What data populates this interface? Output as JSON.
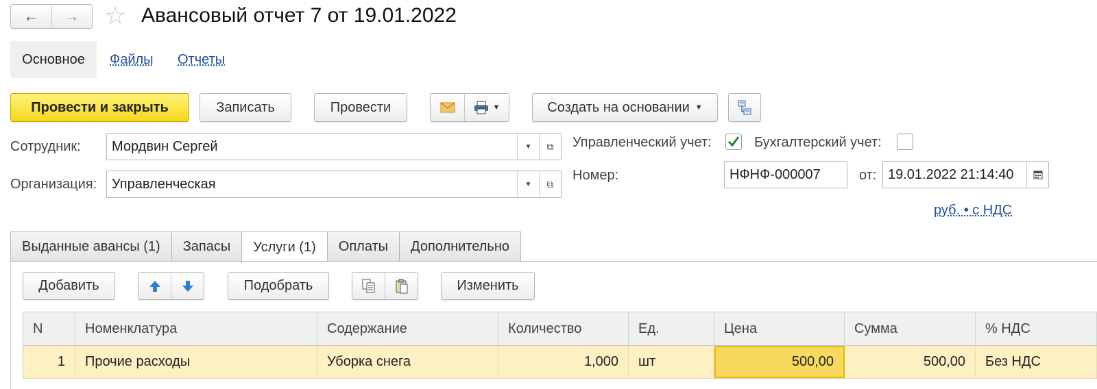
{
  "header": {
    "back_icon": "arrow-left-icon",
    "forward_icon": "arrow-right-icon",
    "favorite_icon": "star-icon",
    "title": "Авансовый отчет 7 от 19.01.2022"
  },
  "panel_tabs": [
    {
      "label": "Основное",
      "active": true
    },
    {
      "label": "Файлы",
      "active": false
    },
    {
      "label": "Отчеты",
      "active": false
    }
  ],
  "toolbar": {
    "post_close": "Провести и закрыть",
    "save": "Записать",
    "post": "Провести",
    "create_based": "Создать на основании"
  },
  "form": {
    "employee_label": "Сотрудник:",
    "employee_value": "Мордвин Сергей",
    "org_label": "Организация:",
    "org_value": "Управленческая",
    "mgmt_label": "Управленческий учет:",
    "mgmt_checked": true,
    "acct_label": "Бухгалтерский учет:",
    "acct_checked": false,
    "number_label": "Номер:",
    "number_value": "НФНФ-000007",
    "date_label": "от:",
    "date_value": "19.01.2022 21:14:40",
    "currency_link": "руб. • с НДС"
  },
  "tabs": [
    {
      "label": "Выданные авансы (1)",
      "active": false
    },
    {
      "label": "Запасы",
      "active": false
    },
    {
      "label": "Услуги (1)",
      "active": true
    },
    {
      "label": "Оплаты",
      "active": false
    },
    {
      "label": "Дополнительно",
      "active": false
    }
  ],
  "grid_toolbar": {
    "add": "Добавить",
    "pick": "Подобрать",
    "change": "Изменить"
  },
  "table": {
    "columns": [
      "N",
      "Номенклатура",
      "Содержание",
      "Количество",
      "Ед.",
      "Цена",
      "Сумма",
      "% НДС"
    ],
    "rows": [
      {
        "n": "1",
        "item": "Прочие расходы",
        "content": "Уборка снега",
        "qty": "1,000",
        "unit": "шт",
        "price": "500,00",
        "sum": "500,00",
        "vat": "Без НДС"
      }
    ]
  },
  "colors": {
    "accent_button": "#f3d81a",
    "row_highlight": "#fdf0c2",
    "focus_cell": "#f8d95d",
    "link": "#1f4e9a",
    "check": "#1e8a2a"
  }
}
